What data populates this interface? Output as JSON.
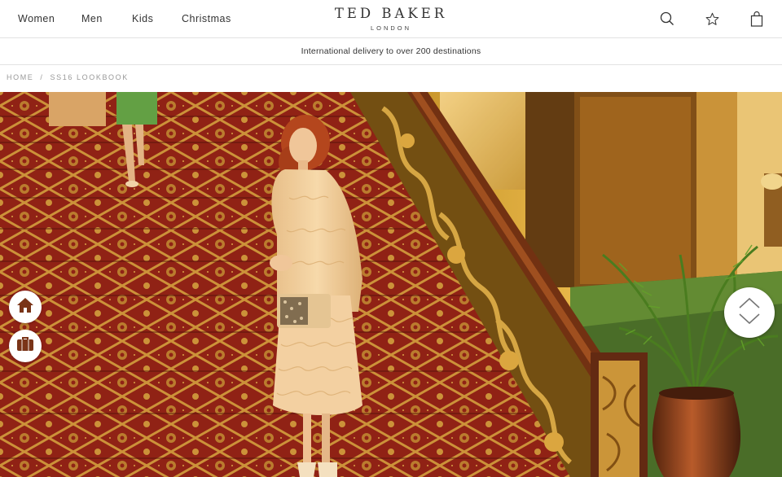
{
  "nav": {
    "items": [
      {
        "label": "Women"
      },
      {
        "label": "Men"
      },
      {
        "label": "Kids"
      },
      {
        "label": "Christmas"
      }
    ],
    "icons": {
      "search": "search-icon",
      "wishlist": "star-icon",
      "bag": "shopping-bag-icon"
    }
  },
  "logo": {
    "name": "TED BAKER",
    "sub": "LONDON"
  },
  "promo": {
    "text": "International delivery to over 200 destinations"
  },
  "breadcrumb": {
    "home": "HOME",
    "separator": "/",
    "current": "SS16 LOOKBOOK"
  },
  "hero": {
    "image_subject": "model in cream quilted cape and dress on red patterned staircase"
  },
  "floating": {
    "home_icon": "home-icon",
    "bag_icon": "briefcase-icon",
    "scroll_icon": "chevron-up-down-icon"
  },
  "colors": {
    "icon_brown": "#7a3418",
    "carpet_red": "#8a1a14",
    "carpet_gold": "#c9913a",
    "rail_wood": "#6a2a10"
  }
}
